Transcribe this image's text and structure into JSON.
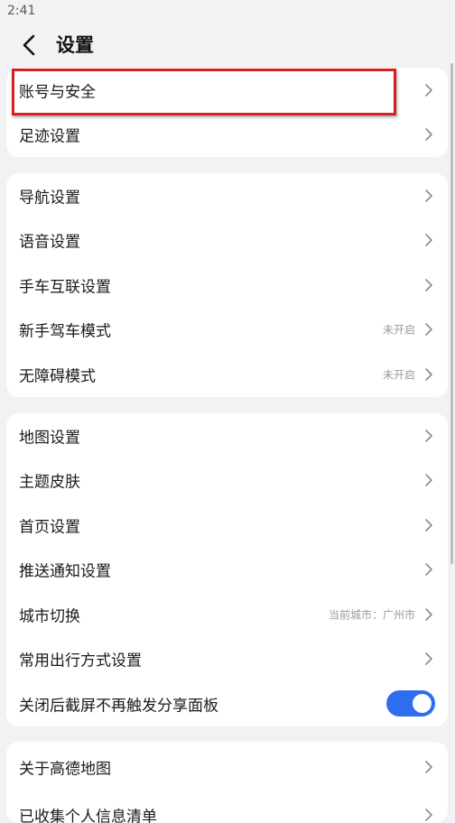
{
  "status_bar": {
    "time": "2:41"
  },
  "header": {
    "title": "设置"
  },
  "groups": [
    {
      "items": [
        {
          "label": "账号与安全"
        },
        {
          "label": "足迹设置"
        }
      ]
    },
    {
      "items": [
        {
          "label": "导航设置"
        },
        {
          "label": "语音设置"
        },
        {
          "label": "手车互联设置"
        },
        {
          "label": "新手驾车模式",
          "value": "未开启"
        },
        {
          "label": "无障碍模式",
          "value": "未开启"
        }
      ]
    },
    {
      "items": [
        {
          "label": "地图设置"
        },
        {
          "label": "主题皮肤"
        },
        {
          "label": "首页设置"
        },
        {
          "label": "推送通知设置"
        },
        {
          "label": "城市切换",
          "value": "当前城市：广州市"
        },
        {
          "label": "常用出行方式设置"
        },
        {
          "label": "关闭后截屏不再触发分享面板",
          "toggle_on": true
        }
      ]
    },
    {
      "items": [
        {
          "label": "关于高德地图"
        },
        {
          "label": "已收集个人信息清单"
        }
      ]
    }
  ],
  "colors": {
    "background": "#f2f2f4",
    "toggle_on": "#2f6df0",
    "highlight": "#d62020"
  },
  "icons": {
    "back": "chevron-left-icon",
    "row_arrow": "chevron-right-icon"
  }
}
